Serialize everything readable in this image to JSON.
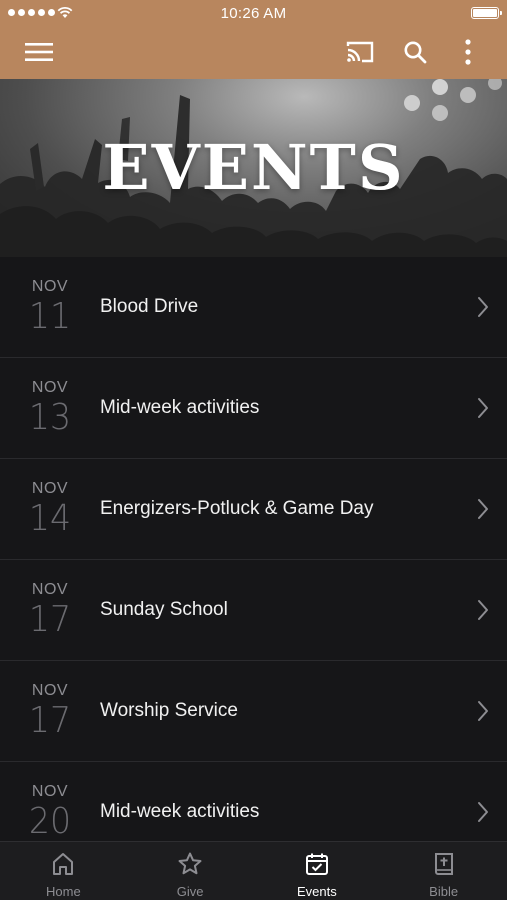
{
  "status_bar": {
    "time": "10:26 AM"
  },
  "header": {
    "menu_icon": "hamburger-menu-icon",
    "cast_icon": "cast-icon",
    "search_icon": "search-icon",
    "more_icon": "more-vertical-icon",
    "background_color": "#b8865e"
  },
  "banner": {
    "title": "EVENTS"
  },
  "events": [
    {
      "month": "NOV",
      "day": "11",
      "title": "Blood Drive"
    },
    {
      "month": "NOV",
      "day": "13",
      "title": "Mid-week activities"
    },
    {
      "month": "NOV",
      "day": "14",
      "title": "Energizers-Potluck & Game Day"
    },
    {
      "month": "NOV",
      "day": "17",
      "title": "Sunday School"
    },
    {
      "month": "NOV",
      "day": "17",
      "title": "Worship Service"
    },
    {
      "month": "NOV",
      "day": "20",
      "title": "Mid-week activities"
    }
  ],
  "tabs": [
    {
      "label": "Home",
      "icon": "home-icon",
      "active": false
    },
    {
      "label": "Give",
      "icon": "star-icon",
      "active": false
    },
    {
      "label": "Events",
      "icon": "calendar-check-icon",
      "active": true
    },
    {
      "label": "Bible",
      "icon": "bible-icon",
      "active": false
    }
  ]
}
